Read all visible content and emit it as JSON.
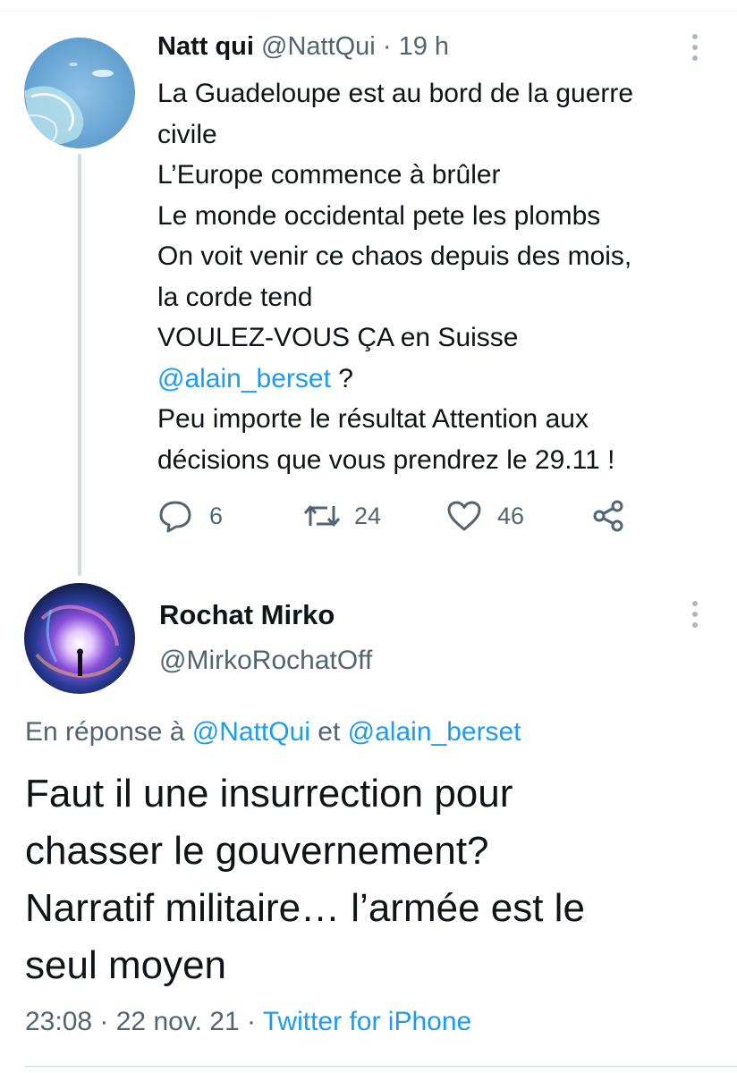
{
  "tweet": {
    "author_name": "Natt qui",
    "author_handle": "@NattQui",
    "separator": "·",
    "time_ago": "19 h",
    "lines": [
      "La Guadeloupe est au bord de la guerre",
      "civile",
      "L’Europe commence à brûler",
      "Le monde occidental pete les plombs",
      "On voit venir ce chaos depuis des mois,",
      "la corde tend",
      "VOULEZ-VOUS ÇA en Suisse"
    ],
    "mention": "@alain_berset",
    "mention_suffix": " ?",
    "lines_after": [
      "Peu importe le résultat Attention aux",
      "décisions que vous prendrez le 29.11 !"
    ],
    "actions": {
      "replies": "6",
      "retweets": "24",
      "likes": "46"
    },
    "icons": {
      "reply": "speech-bubble-icon",
      "retweet": "retweet-arrows-icon",
      "like": "heart-icon",
      "share": "share-icon",
      "more": "vertical-dots-icon"
    }
  },
  "reply": {
    "author_name": "Rochat Mirko",
    "author_handle": "@MirkoRochatOff",
    "reply_prefix": "En réponse à ",
    "reply_mention_1": "@NattQui",
    "reply_conjunction": " et ",
    "reply_mention_2": "@alain_berset",
    "lines": [
      "Faut il une insurrection pour",
      "chasser le gouvernement?",
      "Narratif militaire… l’armée est le",
      "seul moyen"
    ],
    "time": "23:08",
    "separator": " · ",
    "date": "22 nov. 21",
    "source": "Twitter for iPhone"
  },
  "colors": {
    "accent": "#1d9bf0",
    "secondary_text": "#536471",
    "primary_text": "#0f1419"
  }
}
